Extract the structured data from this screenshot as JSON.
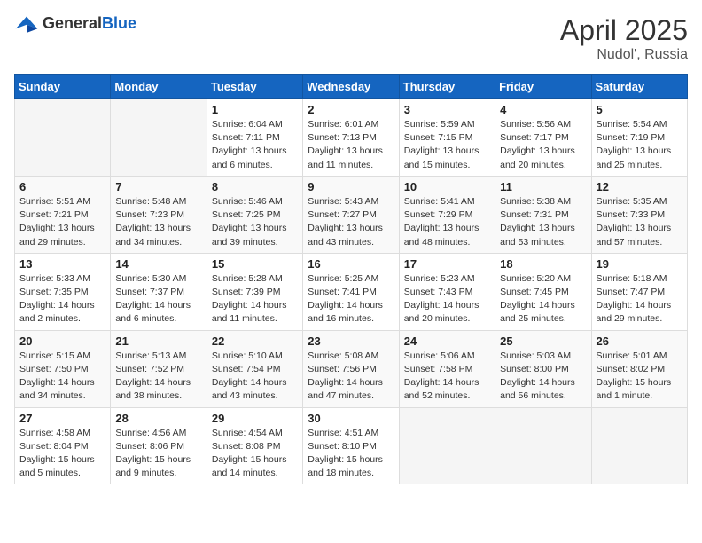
{
  "logo": {
    "general": "General",
    "blue": "Blue"
  },
  "title": {
    "month": "April 2025",
    "location": "Nudol', Russia"
  },
  "weekdays": [
    "Sunday",
    "Monday",
    "Tuesday",
    "Wednesday",
    "Thursday",
    "Friday",
    "Saturday"
  ],
  "weeks": [
    [
      {
        "day": "",
        "info": ""
      },
      {
        "day": "",
        "info": ""
      },
      {
        "day": "1",
        "info": "Sunrise: 6:04 AM\nSunset: 7:11 PM\nDaylight: 13 hours and 6 minutes."
      },
      {
        "day": "2",
        "info": "Sunrise: 6:01 AM\nSunset: 7:13 PM\nDaylight: 13 hours and 11 minutes."
      },
      {
        "day": "3",
        "info": "Sunrise: 5:59 AM\nSunset: 7:15 PM\nDaylight: 13 hours and 15 minutes."
      },
      {
        "day": "4",
        "info": "Sunrise: 5:56 AM\nSunset: 7:17 PM\nDaylight: 13 hours and 20 minutes."
      },
      {
        "day": "5",
        "info": "Sunrise: 5:54 AM\nSunset: 7:19 PM\nDaylight: 13 hours and 25 minutes."
      }
    ],
    [
      {
        "day": "6",
        "info": "Sunrise: 5:51 AM\nSunset: 7:21 PM\nDaylight: 13 hours and 29 minutes."
      },
      {
        "day": "7",
        "info": "Sunrise: 5:48 AM\nSunset: 7:23 PM\nDaylight: 13 hours and 34 minutes."
      },
      {
        "day": "8",
        "info": "Sunrise: 5:46 AM\nSunset: 7:25 PM\nDaylight: 13 hours and 39 minutes."
      },
      {
        "day": "9",
        "info": "Sunrise: 5:43 AM\nSunset: 7:27 PM\nDaylight: 13 hours and 43 minutes."
      },
      {
        "day": "10",
        "info": "Sunrise: 5:41 AM\nSunset: 7:29 PM\nDaylight: 13 hours and 48 minutes."
      },
      {
        "day": "11",
        "info": "Sunrise: 5:38 AM\nSunset: 7:31 PM\nDaylight: 13 hours and 53 minutes."
      },
      {
        "day": "12",
        "info": "Sunrise: 5:35 AM\nSunset: 7:33 PM\nDaylight: 13 hours and 57 minutes."
      }
    ],
    [
      {
        "day": "13",
        "info": "Sunrise: 5:33 AM\nSunset: 7:35 PM\nDaylight: 14 hours and 2 minutes."
      },
      {
        "day": "14",
        "info": "Sunrise: 5:30 AM\nSunset: 7:37 PM\nDaylight: 14 hours and 6 minutes."
      },
      {
        "day": "15",
        "info": "Sunrise: 5:28 AM\nSunset: 7:39 PM\nDaylight: 14 hours and 11 minutes."
      },
      {
        "day": "16",
        "info": "Sunrise: 5:25 AM\nSunset: 7:41 PM\nDaylight: 14 hours and 16 minutes."
      },
      {
        "day": "17",
        "info": "Sunrise: 5:23 AM\nSunset: 7:43 PM\nDaylight: 14 hours and 20 minutes."
      },
      {
        "day": "18",
        "info": "Sunrise: 5:20 AM\nSunset: 7:45 PM\nDaylight: 14 hours and 25 minutes."
      },
      {
        "day": "19",
        "info": "Sunrise: 5:18 AM\nSunset: 7:47 PM\nDaylight: 14 hours and 29 minutes."
      }
    ],
    [
      {
        "day": "20",
        "info": "Sunrise: 5:15 AM\nSunset: 7:50 PM\nDaylight: 14 hours and 34 minutes."
      },
      {
        "day": "21",
        "info": "Sunrise: 5:13 AM\nSunset: 7:52 PM\nDaylight: 14 hours and 38 minutes."
      },
      {
        "day": "22",
        "info": "Sunrise: 5:10 AM\nSunset: 7:54 PM\nDaylight: 14 hours and 43 minutes."
      },
      {
        "day": "23",
        "info": "Sunrise: 5:08 AM\nSunset: 7:56 PM\nDaylight: 14 hours and 47 minutes."
      },
      {
        "day": "24",
        "info": "Sunrise: 5:06 AM\nSunset: 7:58 PM\nDaylight: 14 hours and 52 minutes."
      },
      {
        "day": "25",
        "info": "Sunrise: 5:03 AM\nSunset: 8:00 PM\nDaylight: 14 hours and 56 minutes."
      },
      {
        "day": "26",
        "info": "Sunrise: 5:01 AM\nSunset: 8:02 PM\nDaylight: 15 hours and 1 minute."
      }
    ],
    [
      {
        "day": "27",
        "info": "Sunrise: 4:58 AM\nSunset: 8:04 PM\nDaylight: 15 hours and 5 minutes."
      },
      {
        "day": "28",
        "info": "Sunrise: 4:56 AM\nSunset: 8:06 PM\nDaylight: 15 hours and 9 minutes."
      },
      {
        "day": "29",
        "info": "Sunrise: 4:54 AM\nSunset: 8:08 PM\nDaylight: 15 hours and 14 minutes."
      },
      {
        "day": "30",
        "info": "Sunrise: 4:51 AM\nSunset: 8:10 PM\nDaylight: 15 hours and 18 minutes."
      },
      {
        "day": "",
        "info": ""
      },
      {
        "day": "",
        "info": ""
      },
      {
        "day": "",
        "info": ""
      }
    ]
  ]
}
